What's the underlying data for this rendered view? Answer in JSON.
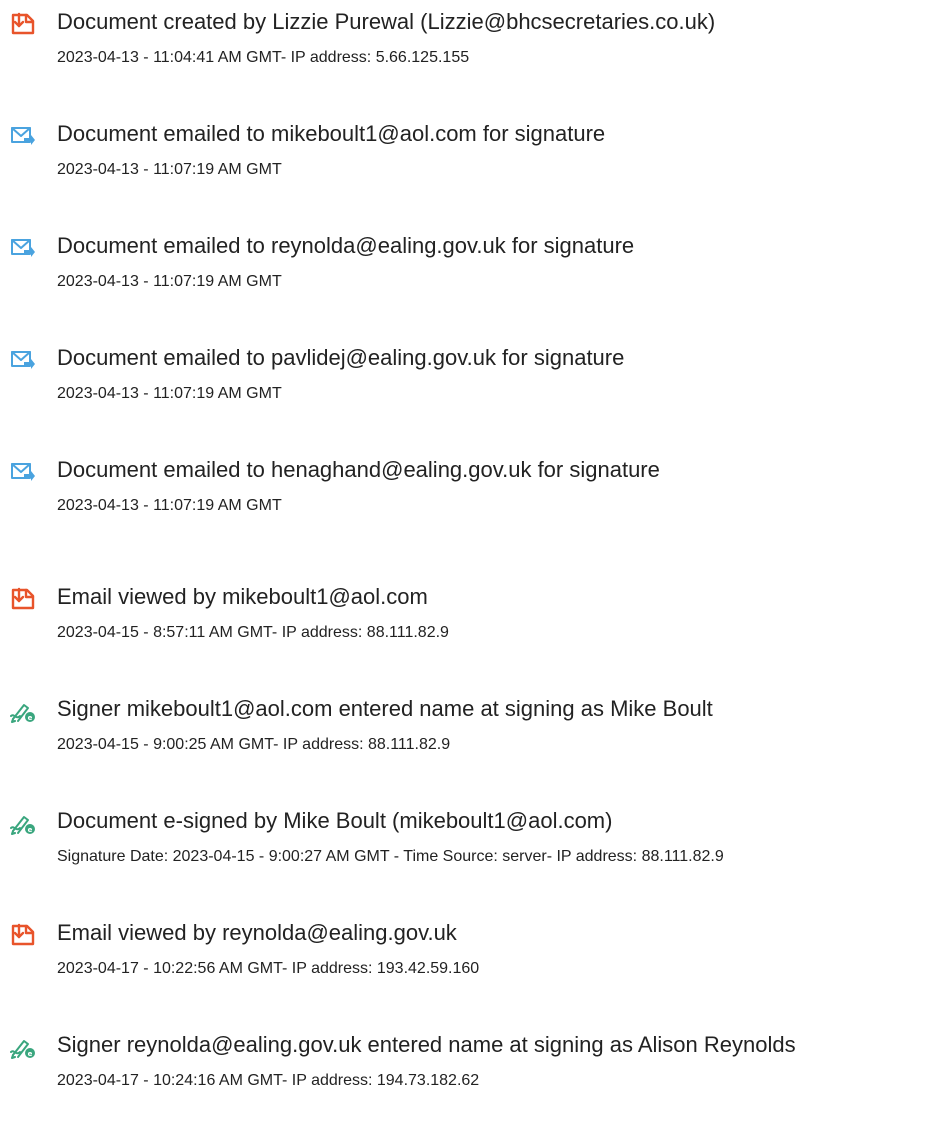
{
  "colors": {
    "pdf_icon": "#e8542b",
    "email_icon": "#4aa3df",
    "sign_icon": "#3aa67e",
    "text": "#222222"
  },
  "events": [
    {
      "icon": "document-icon",
      "title": "Document created by Lizzie Purewal (Lizzie@bhcsecretaries.co.uk)",
      "meta": "2023-04-13 - 11:04:41 AM GMT- IP address: 5.66.125.155"
    },
    {
      "icon": "email-sent-icon",
      "title": "Document emailed to mikeboult1@aol.com for signature",
      "meta": "2023-04-13 - 11:07:19 AM GMT"
    },
    {
      "icon": "email-sent-icon",
      "title": "Document emailed to reynolda@ealing.gov.uk for signature",
      "meta": "2023-04-13 - 11:07:19 AM GMT"
    },
    {
      "icon": "email-sent-icon",
      "title": "Document emailed to pavlidej@ealing.gov.uk for signature",
      "meta": "2023-04-13 - 11:07:19 AM GMT"
    },
    {
      "icon": "email-sent-icon",
      "title": "Document emailed to henaghand@ealing.gov.uk for signature",
      "meta": "2023-04-13 - 11:07:19 AM GMT"
    },
    {
      "icon": "document-icon",
      "title": "Email viewed by mikeboult1@aol.com",
      "meta": "2023-04-15 - 8:57:11 AM GMT- IP address: 88.111.82.9"
    },
    {
      "icon": "signature-pen-icon",
      "title": "Signer mikeboult1@aol.com entered name at signing as Mike Boult",
      "meta": "2023-04-15 - 9:00:25 AM GMT- IP address: 88.111.82.9"
    },
    {
      "icon": "signature-pen-icon",
      "title": "Document e-signed by Mike Boult (mikeboult1@aol.com)",
      "meta": "Signature Date: 2023-04-15 - 9:00:27 AM GMT - Time Source: server- IP address: 88.111.82.9"
    },
    {
      "icon": "document-icon",
      "title": "Email viewed by reynolda@ealing.gov.uk",
      "meta": "2023-04-17 - 10:22:56 AM GMT- IP address: 193.42.59.160"
    },
    {
      "icon": "signature-pen-icon",
      "title": "Signer reynolda@ealing.gov.uk entered name at signing as Alison Reynolds",
      "meta": "2023-04-17 - 10:24:16 AM GMT- IP address: 194.73.182.62"
    }
  ]
}
